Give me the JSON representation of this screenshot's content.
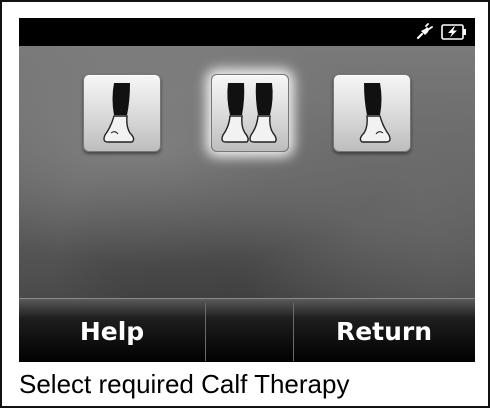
{
  "status": {
    "icons": [
      "plug-icon",
      "battery-charging-icon"
    ]
  },
  "therapy_options": [
    {
      "name": "left-calf",
      "selected": false
    },
    {
      "name": "both-calves",
      "selected": true
    },
    {
      "name": "right-calf",
      "selected": false
    }
  ],
  "softkeys": {
    "left_label": "Help",
    "middle_label": "",
    "right_label": "Return"
  },
  "caption": "Select required Calf Therapy",
  "colors": {
    "screen_bg": "#6e6e6e",
    "bar_bg": "#000000",
    "softkey_text": "#ffffff",
    "leg_fill": "#111111"
  }
}
